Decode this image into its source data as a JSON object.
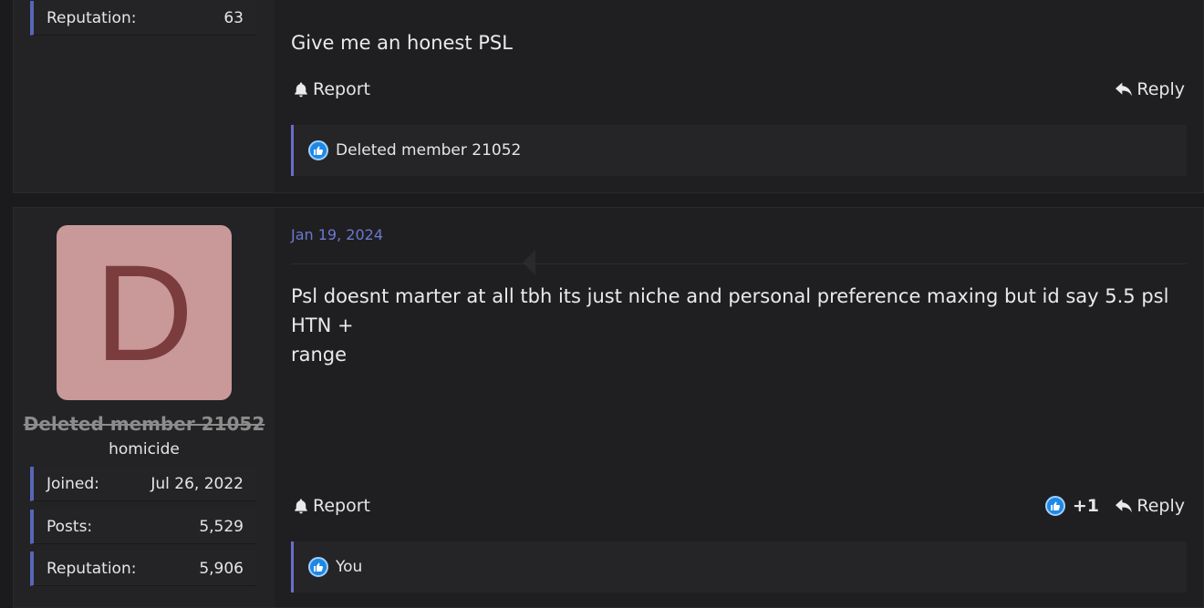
{
  "post_a": {
    "stats": [
      {
        "label": "Reputation:",
        "value": "63"
      }
    ],
    "text": "Give me an honest PSL",
    "report_label": "Report",
    "reply_label": "Reply",
    "reactions_text": "Deleted member 21052"
  },
  "post_b": {
    "avatar_letter": "D",
    "username": "Deleted member 21052",
    "user_title": "homicide",
    "stats": [
      {
        "label": "Joined:",
        "value": "Jul 26, 2022"
      },
      {
        "label": "Posts:",
        "value": "5,529"
      },
      {
        "label": "Reputation:",
        "value": "5,906"
      }
    ],
    "date": "Jan 19, 2024",
    "text_line1": "Psl doesnt marter at all tbh its just niche and personal preference maxing but id say 5.5 psl HTN +",
    "text_line2": "range",
    "report_label": "Report",
    "reaction_score": "+1",
    "reply_label": "Reply",
    "reactions_text": "You"
  },
  "colors": {
    "accent": "#5865b8",
    "date": "#6d78d0",
    "avatar_bg": "#c99898",
    "avatar_letter": "#7a3c3c",
    "like_blue": "#1e88e5"
  },
  "icons": {
    "report": "bell-icon",
    "reply": "reply-arrow-icon",
    "like": "thumbs-up-icon"
  }
}
